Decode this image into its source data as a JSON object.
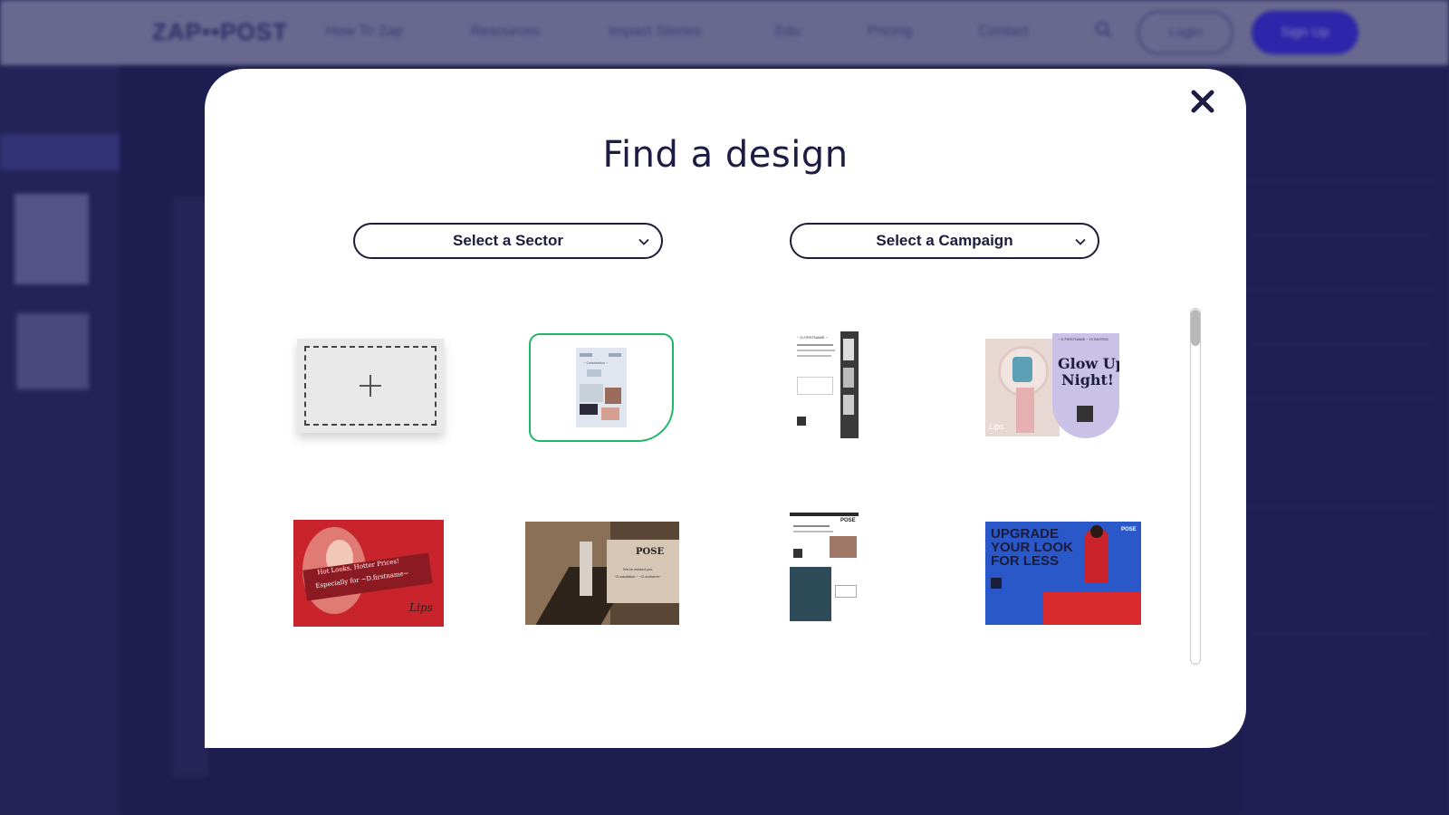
{
  "background": {
    "logo": "ZAP••POST",
    "nav": [
      "How To Zap",
      "Resources",
      "Impact Stories",
      "Edu",
      "Pricing",
      "Contact"
    ],
    "login_label": "Login",
    "signup_label": "Sign Up"
  },
  "modal": {
    "title": "Find a design",
    "sector_select": "Select a Sector",
    "campaign_select": "Select a Campaign",
    "close_icon": "close-icon",
    "designs": {
      "d2": {
        "a": "~ Celebration ~"
      },
      "d3": {
        "a": "~ D.FIRSTNAME ~"
      },
      "d4": {
        "a": "~ D.FIRSTNAME ~ IS INVITED",
        "b": "Glow Up",
        "c": "Night!",
        "d": "Lips"
      },
      "d5": {
        "a": "Hot Looks, Hotter Prices!",
        "b": "Especially for ~D.firstname~",
        "c": "Lips"
      },
      "d6": {
        "a": "POSE",
        "b": "We've missed you,",
        "c": "~D.salutation ~ ~D.surname~"
      },
      "d7": {
        "a": "POSE"
      },
      "d8": {
        "a": "UPGRADE",
        "b": "YOUR LOOK",
        "c": "FOR LESS",
        "d": "POSE"
      }
    }
  },
  "colors": {
    "accent_green": "#21b56a",
    "title_navy": "#1c1c44",
    "signup_blue": "#3a2fd4",
    "poster_red": "#c9242b",
    "poster_blue": "#2a58c8",
    "lavender": "#c9c2e6"
  }
}
